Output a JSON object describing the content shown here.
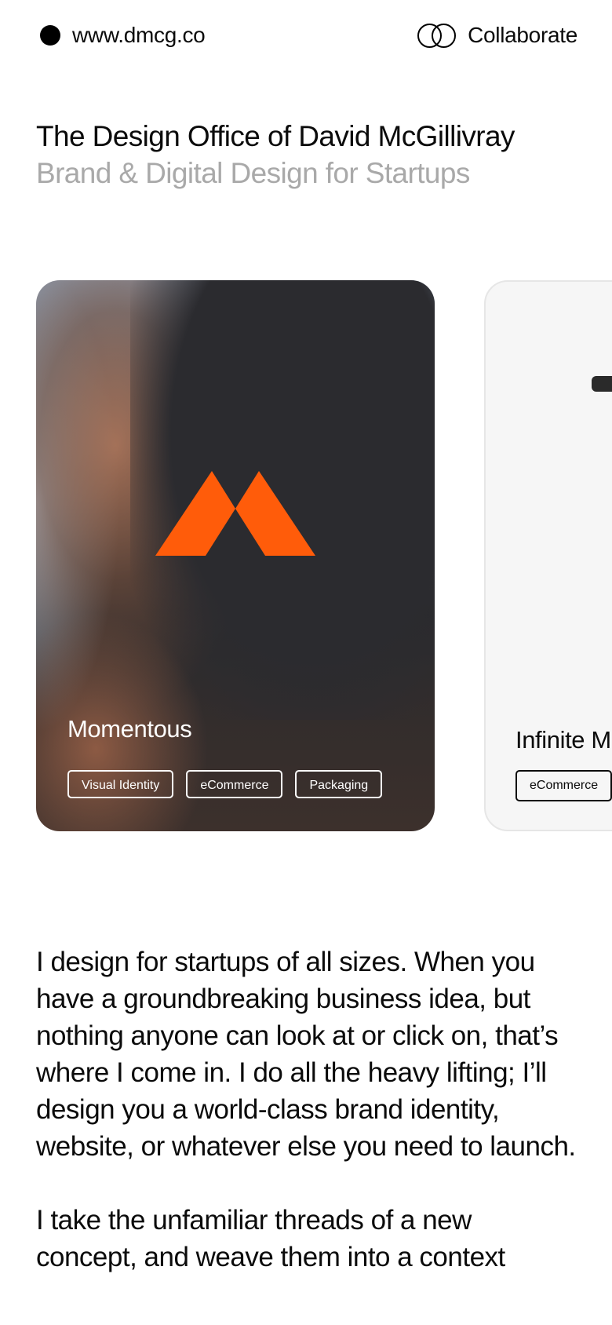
{
  "header": {
    "site_label": "www.dmcg.co",
    "collab_label": "Collaborate"
  },
  "hero": {
    "title": "The Design Office of David McGillivray",
    "subtitle": "Brand & Digital Design for Startups"
  },
  "colors": {
    "brand_orange": "#ff5c0a",
    "subtitle_grey": "#a9a9a9",
    "text": "#0b0b0b"
  },
  "projects": [
    {
      "title": "Momentous",
      "tags": [
        "Visual Identity",
        "eCommerce",
        "Packaging"
      ]
    },
    {
      "title": "Infinite Ma",
      "tags": [
        "eCommerce"
      ]
    }
  ],
  "intro": {
    "p1": "I design for startups of all sizes. When you have a groundbreaking business idea, but nothing anyone can look at or click on, that’s where I come in. I do all the heavy lifting; I’ll design you a world-class brand identity, website, or whatever else you need to launch.",
    "p2": "I take the unfamiliar threads of a new concept, and weave them into a context"
  }
}
